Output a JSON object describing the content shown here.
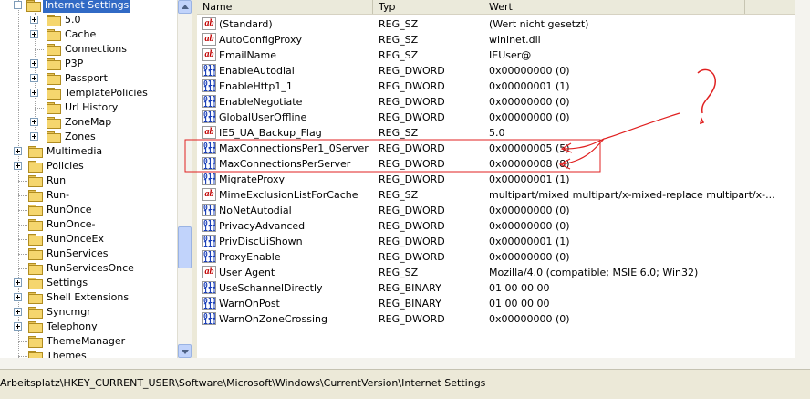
{
  "tree": {
    "selected": "Internet Settings",
    "children_of_selected": [
      "5.0",
      "Cache",
      "Connections",
      "P3P",
      "Passport",
      "TemplatePolicies",
      "Url History",
      "ZoneMap",
      "Zones"
    ],
    "siblings": [
      "Multimedia",
      "Policies",
      "Run",
      "Run-",
      "RunOnce",
      "RunOnce-",
      "RunOnceEx",
      "RunServices",
      "RunServicesOnce",
      "Settings",
      "Shell Extensions",
      "Syncmgr",
      "Telephony",
      "ThemeManager",
      "Themes"
    ]
  },
  "list": {
    "columns": {
      "name": "Name",
      "type": "Typ",
      "value": "Wert"
    },
    "rows": [
      {
        "name": "(Standard)",
        "type": "REG_SZ",
        "value": "(Wert nicht gesetzt)",
        "icon": "string-value-icon"
      },
      {
        "name": "AutoConfigProxy",
        "type": "REG_SZ",
        "value": "wininet.dll",
        "icon": "string-value-icon"
      },
      {
        "name": "EmailName",
        "type": "REG_SZ",
        "value": "IEUser@",
        "icon": "string-value-icon"
      },
      {
        "name": "EnableAutodial",
        "type": "REG_DWORD",
        "value": "0x00000000 (0)",
        "icon": "binary-value-icon"
      },
      {
        "name": "EnableHttp1_1",
        "type": "REG_DWORD",
        "value": "0x00000001 (1)",
        "icon": "binary-value-icon"
      },
      {
        "name": "EnableNegotiate",
        "type": "REG_DWORD",
        "value": "0x00000000 (0)",
        "icon": "binary-value-icon"
      },
      {
        "name": "GlobalUserOffline",
        "type": "REG_DWORD",
        "value": "0x00000000 (0)",
        "icon": "binary-value-icon"
      },
      {
        "name": "IE5_UA_Backup_Flag",
        "type": "REG_SZ",
        "value": "5.0",
        "icon": "string-value-icon"
      },
      {
        "name": "MaxConnectionsPer1_0Server",
        "type": "REG_DWORD",
        "value": "0x00000005 (5)",
        "icon": "binary-value-icon"
      },
      {
        "name": "MaxConnectionsPerServer",
        "type": "REG_DWORD",
        "value": "0x00000008 (8)",
        "icon": "binary-value-icon"
      },
      {
        "name": "MigrateProxy",
        "type": "REG_DWORD",
        "value": "0x00000001 (1)",
        "icon": "binary-value-icon"
      },
      {
        "name": "MimeExclusionListForCache",
        "type": "REG_SZ",
        "value": "multipart/mixed multipart/x-mixed-replace multipart/x-...",
        "icon": "string-value-icon"
      },
      {
        "name": "NoNetAutodial",
        "type": "REG_DWORD",
        "value": "0x00000000 (0)",
        "icon": "binary-value-icon"
      },
      {
        "name": "PrivacyAdvanced",
        "type": "REG_DWORD",
        "value": "0x00000000 (0)",
        "icon": "binary-value-icon"
      },
      {
        "name": "PrivDiscUiShown",
        "type": "REG_DWORD",
        "value": "0x00000001 (1)",
        "icon": "binary-value-icon"
      },
      {
        "name": "ProxyEnable",
        "type": "REG_DWORD",
        "value": "0x00000000 (0)",
        "icon": "binary-value-icon"
      },
      {
        "name": "User Agent",
        "type": "REG_SZ",
        "value": "Mozilla/4.0 (compatible; MSIE 6.0; Win32)",
        "icon": "string-value-icon"
      },
      {
        "name": "UseSchannelDirectly",
        "type": "REG_BINARY",
        "value": "01 00 00 00",
        "icon": "binary-value-icon"
      },
      {
        "name": "WarnOnPost",
        "type": "REG_BINARY",
        "value": "01 00 00 00",
        "icon": "binary-value-icon"
      },
      {
        "name": "WarnOnZoneCrossing",
        "type": "REG_DWORD",
        "value": "0x00000000 (0)",
        "icon": "binary-value-icon"
      }
    ]
  },
  "annotation": {
    "text": "?",
    "color": "#e02020"
  },
  "statusbar": {
    "path": "Arbeitsplatz\\HKEY_CURRENT_USER\\Software\\Microsoft\\Windows\\CurrentVersion\\Internet Settings"
  },
  "colors": {
    "selection": "#316ac5",
    "folder": "#f5d66e",
    "annotation": "#e02020"
  }
}
